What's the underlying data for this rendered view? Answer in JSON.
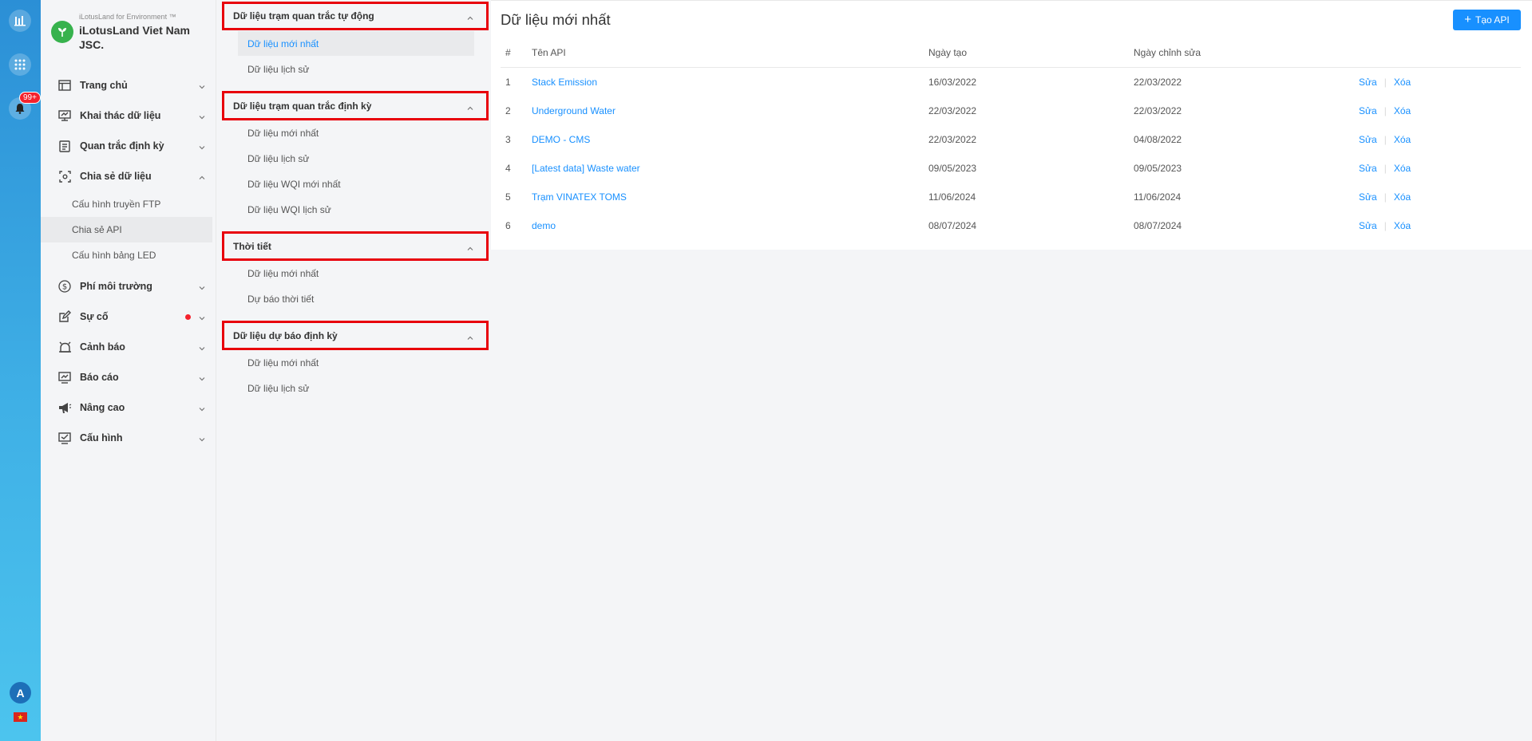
{
  "brand": {
    "tagline": "iLotusLand for Environment ™",
    "name": "iLotusLand Viet Nam JSC."
  },
  "rail": {
    "notification_badge": "99+",
    "avatar_letter": "A",
    "flag": "★"
  },
  "sidebar": {
    "items": [
      {
        "label": "Trang chủ",
        "icon": "home-icon"
      },
      {
        "label": "Khai thác dữ liệu",
        "icon": "monitor-icon"
      },
      {
        "label": "Quan trắc định kỳ",
        "icon": "document-icon"
      },
      {
        "label": "Chia sẻ dữ liệu",
        "icon": "share-icon",
        "expanded": true
      },
      {
        "label": "Phí môi trường",
        "icon": "dollar-icon"
      },
      {
        "label": "Sự cố",
        "icon": "edit-icon",
        "has_dot": true
      },
      {
        "label": "Cảnh báo",
        "icon": "alarm-icon"
      },
      {
        "label": "Báo cáo",
        "icon": "report-icon"
      },
      {
        "label": "Nâng cao",
        "icon": "megaphone-icon"
      },
      {
        "label": "Cấu hình",
        "icon": "config-icon"
      }
    ],
    "share_children": [
      "Cấu hình truyền FTP",
      "Chia sẻ API",
      "Cấu hình bảng LED"
    ],
    "active_child": "Chia sẻ API"
  },
  "panel2": {
    "groups": [
      {
        "title": "Dữ liệu trạm quan trắc tự động",
        "items": [
          "Dữ liệu mới nhất",
          "Dữ liệu lịch sử"
        ]
      },
      {
        "title": "Dữ liệu trạm quan trắc định kỳ",
        "items": [
          "Dữ liệu mới nhất",
          "Dữ liệu lịch sử",
          "Dữ liệu WQI mới nhất",
          "Dữ liệu WQI lịch sử"
        ]
      },
      {
        "title": "Thời tiết",
        "items": [
          "Dữ liệu mới nhất",
          "Dự báo thời tiết"
        ]
      },
      {
        "title": "Dữ liệu dự báo định kỳ",
        "items": [
          "Dữ liệu mới nhất",
          "Dữ liệu lịch sử"
        ]
      }
    ]
  },
  "main": {
    "title": "Dữ liệu mới nhất",
    "create_button": "Tạo API",
    "columns": {
      "idx": "#",
      "name": "Tên API",
      "created": "Ngày tạo",
      "edited": "Ngày chỉnh sửa"
    },
    "edit_label": "Sửa",
    "delete_label": "Xóa",
    "rows": [
      {
        "idx": "1",
        "name": "Stack Emission",
        "created": "16/03/2022",
        "edited": "22/03/2022"
      },
      {
        "idx": "2",
        "name": "Underground Water",
        "created": "22/03/2022",
        "edited": "22/03/2022"
      },
      {
        "idx": "3",
        "name": "DEMO - CMS",
        "created": "22/03/2022",
        "edited": "04/08/2022"
      },
      {
        "idx": "4",
        "name": "[Latest data] Waste water",
        "created": "09/05/2023",
        "edited": "09/05/2023"
      },
      {
        "idx": "5",
        "name": "Trạm VINATEX TOMS",
        "created": "11/06/2024",
        "edited": "11/06/2024"
      },
      {
        "idx": "6",
        "name": "demo",
        "created": "08/07/2024",
        "edited": "08/07/2024"
      }
    ]
  },
  "colors": {
    "accent": "#1890ff",
    "highlight_border": "#e8000b",
    "rail_top": "#2b8fd6",
    "rail_bottom": "#4cc4ee"
  }
}
